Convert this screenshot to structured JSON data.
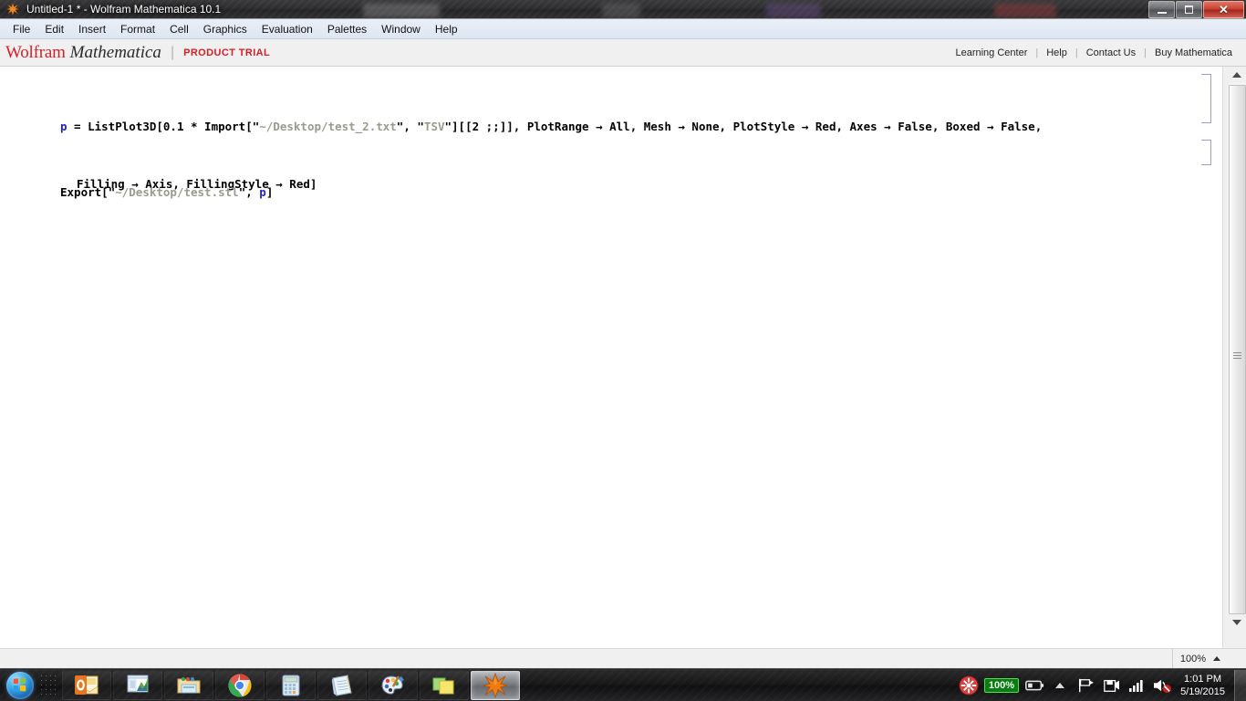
{
  "window": {
    "title": "Untitled-1 * - Wolfram Mathematica 10.1",
    "app_icon": "mathematica-spikey-icon",
    "controls": {
      "minimize": "minimize-button",
      "restore": "restore-button",
      "close_glyph": "✕"
    }
  },
  "menubar": {
    "items": [
      {
        "label": "File"
      },
      {
        "label": "Edit"
      },
      {
        "label": "Insert"
      },
      {
        "label": "Format"
      },
      {
        "label": "Cell"
      },
      {
        "label": "Graphics"
      },
      {
        "label": "Evaluation"
      },
      {
        "label": "Palettes"
      },
      {
        "label": "Window"
      },
      {
        "label": "Help"
      }
    ]
  },
  "brandbar": {
    "wolfram": "Wolfram",
    "mathematica": "Mathematica",
    "separator": "|",
    "trial": "PRODUCT TRIAL",
    "links": [
      {
        "label": "Learning Center"
      },
      {
        "label": "Help"
      },
      {
        "label": "Contact Us"
      },
      {
        "label": "Buy "
      },
      {
        "label": "Mathematica"
      }
    ],
    "link_separator": "|",
    "colors": {
      "brand_red": "#d61f26",
      "text_dark": "#2b2b2b"
    }
  },
  "notebook": {
    "cells": [
      {
        "name": "input-cell-1",
        "line1": {
          "var": "p",
          "eq": " = ",
          "fn": "ListPlot3D[0.1 ",
          "star": "*",
          "fn2": " Import[",
          "q1": "\"",
          "path": "~/Desktop/test_2.txt",
          "q2": "\"",
          "comma1": ", ",
          "q3": "\"",
          "tsv": "TSV",
          "q4": "\"",
          "rest": "][[2 ;;]], PlotRange → All, Mesh → None, PlotStyle → Red, Axes → False, Boxed → False,"
        },
        "line2": "Filling → Axis, FillingStyle → Red]"
      },
      {
        "name": "input-cell-2",
        "line1": {
          "fn": "Export[",
          "q1": "\"",
          "path": "~/Desktop/test.stl",
          "q2": "\"",
          "comma": ", ",
          "var": "p",
          "close": "]"
        }
      }
    ],
    "colors": {
      "variable": "#2020dd",
      "string": "#9a9a8e",
      "code": "#000000",
      "cell_bracket": "#9a9ec4"
    }
  },
  "scrollbar": {
    "up_arrow": "scroll-up-arrow-icon",
    "down_arrow": "scroll-down-arrow-icon",
    "grip": "scrollbar-grip-icon"
  },
  "statusbar": {
    "zoom_level": "100%",
    "zoom_caret": "caret-up-icon"
  },
  "taskbar": {
    "start": "windows-start-orb-icon",
    "items": [
      {
        "name": "taskbar-item-outlook",
        "icon": "outlook-icon"
      },
      {
        "name": "taskbar-item-excel",
        "icon": "excel-chart-icon"
      },
      {
        "name": "taskbar-item-explorer",
        "icon": "folder-explorer-icon"
      },
      {
        "name": "taskbar-item-chrome",
        "icon": "chrome-icon"
      },
      {
        "name": "taskbar-item-calculator",
        "icon": "calculator-icon"
      },
      {
        "name": "taskbar-item-notepad",
        "icon": "notepad-icon"
      },
      {
        "name": "taskbar-item-paint",
        "icon": "paint-palette-icon"
      },
      {
        "name": "taskbar-item-sticky-notes",
        "icon": "sticky-notes-icon"
      },
      {
        "name": "taskbar-item-mathematica",
        "icon": "mathematica-spikey-icon",
        "active": true
      }
    ],
    "tray": {
      "overflow_arrow": "tray-overflow-arrow-icon",
      "icons": [
        {
          "name": "tray-red-app-icon"
        },
        {
          "name": "tray-flag-action-center-icon"
        },
        {
          "name": "tray-removable-media-icon"
        },
        {
          "name": "tray-network-signal-icon"
        },
        {
          "name": "tray-volume-muted-icon"
        }
      ],
      "battery": {
        "percent": "100%",
        "icon": "battery-icon"
      },
      "clock": {
        "time": "1:01 PM",
        "date": "5/19/2015"
      }
    },
    "show_desktop": "show-desktop-button"
  }
}
